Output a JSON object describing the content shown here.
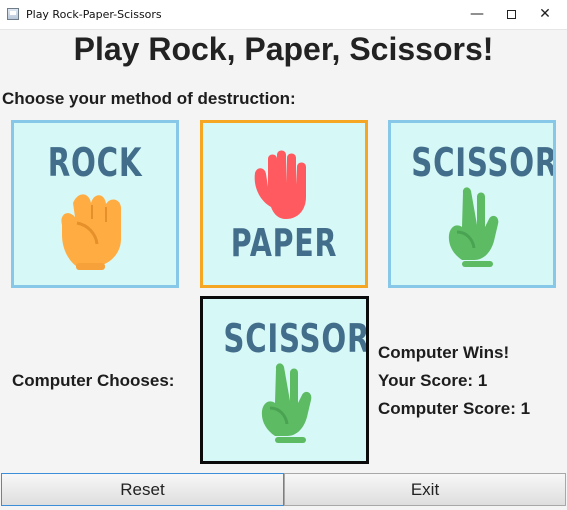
{
  "window": {
    "title": "Play Rock-Paper-Scissors",
    "minimize": "—",
    "close": "✕"
  },
  "main": {
    "title": "Play Rock, Paper, Scissors!",
    "prompt": "Choose your method of destruction:"
  },
  "choices": [
    {
      "label": "ROCK",
      "selected": false,
      "color": "#ffad42"
    },
    {
      "label": "PAPER",
      "selected": true,
      "color": "#ff5a5f"
    },
    {
      "label": "SCISSORS",
      "selected": false,
      "color": "#5dbb63"
    }
  ],
  "computer": {
    "label": "Computer Chooses:",
    "choice": "SCISSORS"
  },
  "results": {
    "outcome": "Computer Wins!",
    "your_score": "Your Score: 1",
    "computer_score": "Computer Score: 1"
  },
  "buttons": {
    "reset": "Reset",
    "exit": "Exit"
  },
  "colors": {
    "card_bg": "#d6f8f6",
    "card_border": "#87c8e8",
    "selected_border": "#f5a623",
    "computer_border": "#0b0b0b",
    "word_color": "#426d8b"
  }
}
